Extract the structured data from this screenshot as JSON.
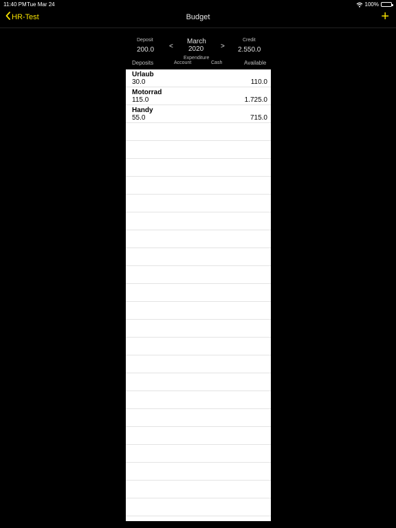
{
  "status": {
    "time": "11:40 PM",
    "date": "Tue Mar 24",
    "battery": "100%"
  },
  "nav": {
    "back_label": "HR-Test",
    "title": "Budget",
    "add_label": "+"
  },
  "summary": {
    "deposit_label": "Deposit",
    "deposit_value": "200.0",
    "month": "March",
    "year": "2020",
    "prev": "<",
    "next": ">",
    "credit_label": "Credit",
    "credit_value": "2.550.0",
    "expenditure_label": "Expenditure",
    "deposits_header": "Deposits",
    "account_header": "Account",
    "cash_header": "Cash",
    "available_header": "Available"
  },
  "rows": [
    {
      "name": "Urlaub",
      "amount": "30.0",
      "available": "110.0"
    },
    {
      "name": "Motorrad",
      "amount": "115.0",
      "available": "1.725.0"
    },
    {
      "name": "Handy",
      "amount": "55.0",
      "available": "715.0"
    }
  ],
  "empty_rows": 22,
  "colors": {
    "accent": "#f7e200",
    "background": "#000000",
    "table": "#ffffff"
  }
}
